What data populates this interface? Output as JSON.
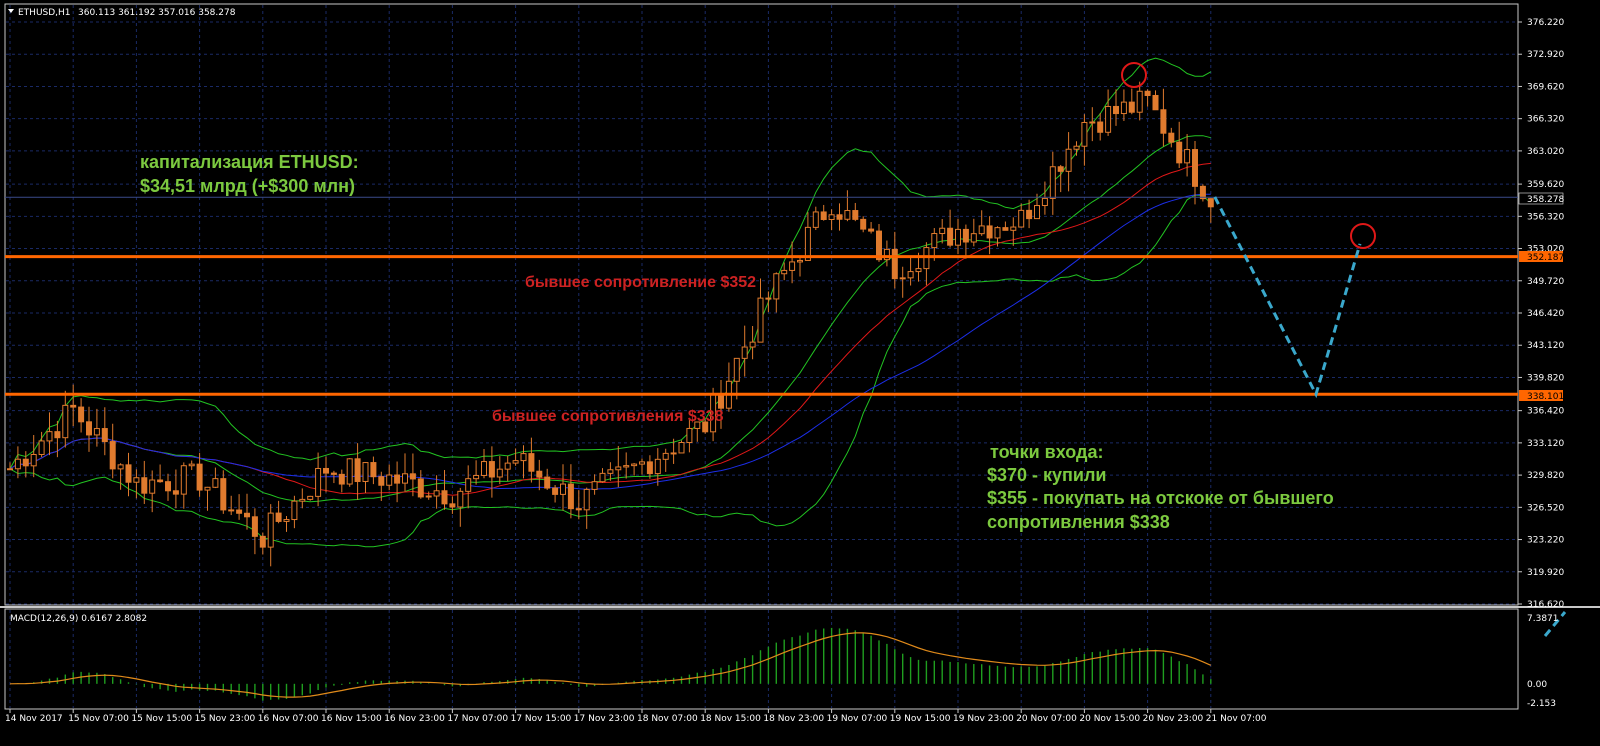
{
  "header": {
    "symbol_label": "ETHUSD,H1",
    "ohlc_label": "360.113 361.192 357.016 358.278"
  },
  "macd_header": {
    "label": "MACD(12,26,9) 0.6167 2.8082"
  },
  "price_axis": {
    "ticks": [
      "376.220",
      "372.920",
      "369.620",
      "366.320",
      "363.020",
      "359.620",
      "356.320",
      "353.020",
      "349.720",
      "346.420",
      "343.120",
      "339.820",
      "336.420",
      "333.120",
      "329.820",
      "326.520",
      "323.220",
      "319.920",
      "316.620"
    ],
    "range": [
      316.62,
      376.22
    ]
  },
  "macd_axis": {
    "ticks": [
      "7.3871",
      "0.00",
      "-2.153"
    ],
    "range": [
      -2.153,
      7.3871
    ]
  },
  "time_axis": {
    "labels": [
      "14 Nov 2017",
      "15 Nov 07:00",
      "15 Nov 15:00",
      "15 Nov 23:00",
      "16 Nov 07:00",
      "16 Nov 15:00",
      "16 Nov 23:00",
      "17 Nov 07:00",
      "17 Nov 15:00",
      "17 Nov 23:00",
      "18 Nov 07:00",
      "18 Nov 15:00",
      "18 Nov 23:00",
      "19 Nov 07:00",
      "19 Nov 15:00",
      "19 Nov 23:00",
      "20 Nov 07:00",
      "20 Nov 15:00",
      "20 Nov 23:00",
      "21 Nov 07:00"
    ]
  },
  "price_tags": {
    "current": "358.278",
    "level_high": "352.187",
    "level_low": "338.101"
  },
  "annotations": {
    "cap_line1": "капитализация ETHUSD:",
    "cap_line2": "$34,51 млрд (+$300 млн)",
    "resist_352": "бывшее сопротивление $352",
    "resist_338": "бывшее сопротивления $338",
    "entry_title": "точки входа:",
    "entry_line1": "$370 - купили",
    "entry_line2": "$355 - покупать на отскоке от бывшего",
    "entry_line3": "сопротивления $338"
  },
  "colors": {
    "background": "#000000",
    "grid": "#1a2a66",
    "candle": "#e07b2e",
    "level_line": "#ff6600",
    "bb": "#22c322",
    "ma_red": "#e01818",
    "ma_blue": "#1c2ee8",
    "macd_hist": "#1f9e1f",
    "macd_signal": "#e08a1a",
    "forecast": "#3aa8cc",
    "circle": "#e01818"
  },
  "chart_data": {
    "type": "candlestick",
    "symbol": "ETHUSD",
    "timeframe": "H1",
    "horizontal_levels": [
      352.187,
      338.101
    ],
    "current_price": 358.278,
    "forecast_path": [
      {
        "x": "21 Nov 07:00",
        "y": 358.3
      },
      {
        "x": "after 21 Nov 07:00",
        "y": 338.1
      },
      {
        "x": "after 21 Nov 07:00",
        "y": 353.5
      }
    ],
    "approx_close_path": [
      {
        "x": "14 Nov 2017",
        "y": 330.5
      },
      {
        "x": "15 Nov 07:00",
        "y": 336.5
      },
      {
        "x": "15 Nov 15:00",
        "y": 329.0
      },
      {
        "x": "15 Nov 23:00",
        "y": 329.5
      },
      {
        "x": "16 Nov 07:00",
        "y": 323.5
      },
      {
        "x": "16 Nov 15:00",
        "y": 330.5
      },
      {
        "x": "16 Nov 23:00",
        "y": 329.5
      },
      {
        "x": "17 Nov 07:00",
        "y": 328.0
      },
      {
        "x": "17 Nov 15:00",
        "y": 331.5
      },
      {
        "x": "17 Nov 23:00",
        "y": 327.0
      },
      {
        "x": "18 Nov 07:00",
        "y": 331.0
      },
      {
        "x": "18 Nov 15:00",
        "y": 335.0
      },
      {
        "x": "18 Nov 23:00",
        "y": 348.0
      },
      {
        "x": "19 Nov 07:00",
        "y": 358.0
      },
      {
        "x": "19 Nov 15:00",
        "y": 351.0
      },
      {
        "x": "19 Nov 23:00",
        "y": 355.0
      },
      {
        "x": "20 Nov 07:00",
        "y": 356.0
      },
      {
        "x": "20 Nov 15:00",
        "y": 366.0
      },
      {
        "x": "20 Nov 23:00",
        "y": 368.0
      },
      {
        "x": "21 Nov 07:00",
        "y": 358.3
      }
    ]
  }
}
